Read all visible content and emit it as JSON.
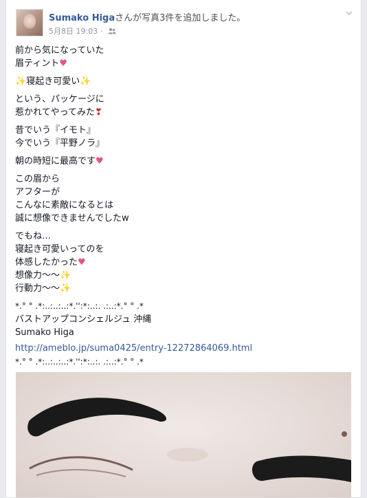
{
  "post": {
    "author": "Sumako Higa",
    "action": "さんが写真3件を追加しました。",
    "date": "5月8日 19:03",
    "separator": "·",
    "audience_icon": "friends-icon",
    "menu_icon": "chevron-down-icon"
  },
  "content": {
    "p1": [
      "前から気になっていた",
      "眉ティント"
    ],
    "p2": [
      "寝起き可愛い"
    ],
    "p3": [
      "という、パッケージに",
      "惹かれてやってみた"
    ],
    "p4": [
      "昔でいう『イモト』",
      "今でいう『平野ノラ』"
    ],
    "p5": [
      "朝の時短に最高です"
    ],
    "p6": [
      "この眉から",
      "アフターが",
      "こんなに素敵になるとは",
      "誠に想像できませんでしたw"
    ],
    "p7": [
      "でもね…",
      "寝起き可愛いってのを",
      "体感したかった",
      "想像力〜〜",
      "行動力〜〜"
    ],
    "divider": "*.° ° .*:..:..:..:*.'':*:..:. .:..:*.° ° .*",
    "sig1": "バストアップコンシェルジュ 沖縄",
    "sig2": "Sumako Higa",
    "url": "http://ameblo.jp/suma0425/entry-12272864069.html",
    "divider2": "*.° ° .*:..:..:..:*.'':*:..:. .:..:*.° ° .*"
  },
  "emoji": {
    "heart": "♥",
    "red_heart": "❣",
    "sparkles": "✨"
  },
  "colors": {
    "link": "#365899",
    "heart": "#e8527a",
    "background": "#e9ebee"
  }
}
